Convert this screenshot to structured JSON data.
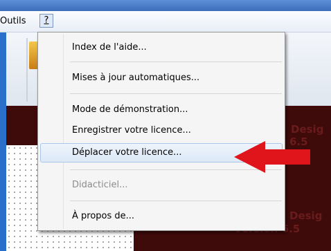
{
  "menubar": {
    "outils_label": "Outils",
    "help_label": "?"
  },
  "menu": {
    "items": [
      {
        "label": "Index de l'aide...",
        "enabled": true
      },
      {
        "label": "Mises à jour automatiques...",
        "enabled": true
      },
      {
        "label": "Mode de démonstration...",
        "enabled": true
      },
      {
        "label": "Enregistrer votre licence...",
        "enabled": true
      },
      {
        "label": "Déplacer votre licence...",
        "enabled": true,
        "highlighted": true
      },
      {
        "label": "Didacticiel...",
        "enabled": false
      },
      {
        "label": "À propos de...",
        "enabled": true
      }
    ]
  },
  "background_watermark": {
    "line1": "Desig",
    "line2": "6.5",
    "line3": "Desig",
    "line4": "Version 6.5"
  },
  "colors": {
    "pointer_arrow": "#e0141b",
    "highlight": "#dde9f8",
    "dark_panel": "#3f0a0a"
  }
}
